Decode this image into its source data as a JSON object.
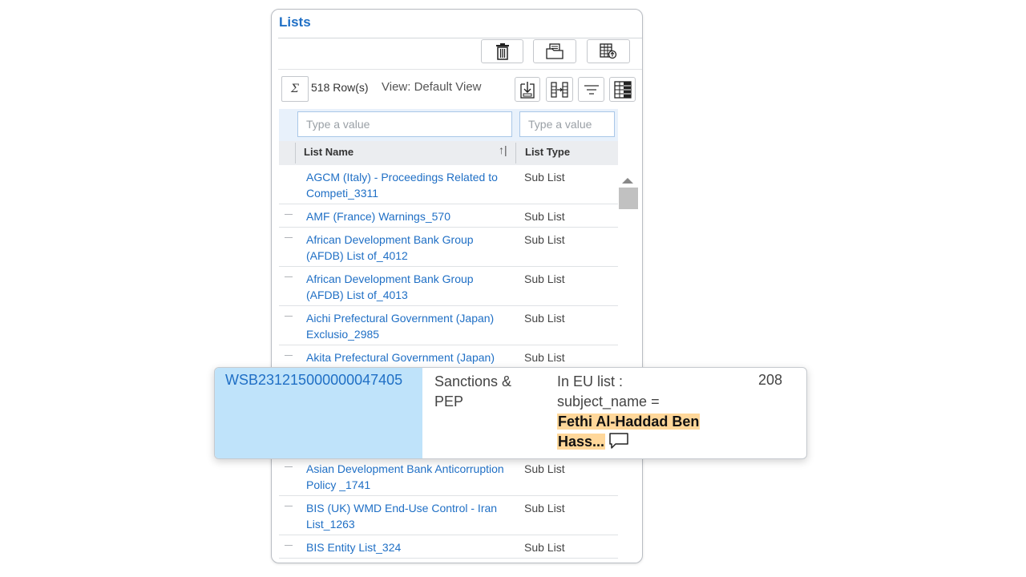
{
  "panel": {
    "title": "Lists",
    "toolbar_top": {
      "icons": [
        "trash-icon",
        "folder-icon",
        "grid-export-icon"
      ]
    },
    "toolbar": {
      "sum_symbol": "Σ",
      "row_count": "518 Row(s)",
      "view_label": "View: Default View",
      "icons": [
        "download-icon",
        "columns-move-icon",
        "filter-icon",
        "column-chooser-icon"
      ]
    },
    "filters": {
      "list_name_placeholder": "Type a value",
      "list_type_placeholder": "Type a value"
    },
    "columns": {
      "list_name": "List Name",
      "list_type": "List Type",
      "sort_glyph": "↑|"
    },
    "rows": [
      {
        "name": "AGCM (Italy) - Proceedings Related to Competi_3311",
        "type": "Sub List"
      },
      {
        "name": "AMF (France) Warnings_570",
        "type": "Sub List"
      },
      {
        "name": "African Development Bank Group (AFDB) List of_4012",
        "type": "Sub List"
      },
      {
        "name": "African Development Bank Group (AFDB) List of_4013",
        "type": "Sub List"
      },
      {
        "name": "Aichi Prefectural Government (Japan) Exclusio_2985",
        "type": "Sub List"
      },
      {
        "name": "Akita Prefectural Government (Japan)",
        "type": "Sub List"
      },
      {
        "name": "",
        "type": ""
      },
      {
        "name": "",
        "type": ""
      },
      {
        "name": "Asian Development Bank Anticorruption Policy _1741",
        "type": "Sub List"
      },
      {
        "name": "BIS (UK) WMD End-Use Control - Iran List_1263",
        "type": "Sub List"
      },
      {
        "name": "BIS Entity List_324",
        "type": "Sub List"
      }
    ]
  },
  "overlay": {
    "id": "WSB231215000000047405",
    "category": "Sanctions & PEP",
    "reason_prefix": "In EU list :",
    "reason_field": "subject_name =",
    "reason_match_1": "Fethi Al-Haddad Ben",
    "reason_match_2": "Hass...",
    "score": "208",
    "highlight_color": "#ffd79a",
    "id_bg_color": "#bfe3fa"
  },
  "colors": {
    "accent": "#1f6fc5"
  }
}
